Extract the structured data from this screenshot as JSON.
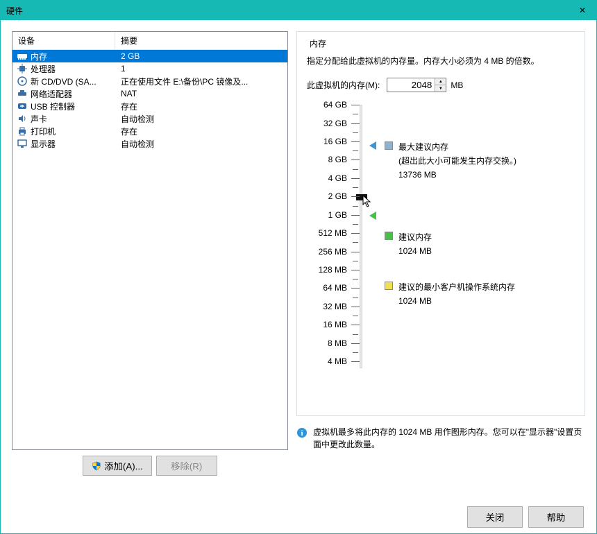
{
  "window": {
    "title": "硬件",
    "close_icon": "✕"
  },
  "device_list": {
    "header_device": "设备",
    "header_summary": "摘要",
    "rows": [
      {
        "icon": "memory",
        "name": "内存",
        "summary": "2 GB",
        "selected": true
      },
      {
        "icon": "cpu",
        "name": "处理器",
        "summary": "1",
        "selected": false
      },
      {
        "icon": "cd",
        "name": "新 CD/DVD (SA...",
        "summary": "正在使用文件 E:\\备份\\PC 镜像及...",
        "selected": false
      },
      {
        "icon": "net",
        "name": "网络适配器",
        "summary": "NAT",
        "selected": false
      },
      {
        "icon": "usb",
        "name": "USB 控制器",
        "summary": "存在",
        "selected": false
      },
      {
        "icon": "sound",
        "name": "声卡",
        "summary": "自动检测",
        "selected": false
      },
      {
        "icon": "printer",
        "name": "打印机",
        "summary": "存在",
        "selected": false
      },
      {
        "icon": "display",
        "name": "显示器",
        "summary": "自动检测",
        "selected": false
      }
    ]
  },
  "buttons": {
    "add": "添加(A)...",
    "remove": "移除(R)"
  },
  "memory_panel": {
    "title": "内存",
    "desc": "指定分配给此虚拟机的内存量。内存大小必须为 4 MB 的倍数。",
    "input_label": "此虚拟机的内存(M):",
    "input_value": "2048",
    "unit": "MB",
    "slider_labels": [
      "64 GB",
      "32 GB",
      "16 GB",
      "8 GB",
      "4 GB",
      "2 GB",
      "1 GB",
      "512 MB",
      "256 MB",
      "128 MB",
      "64 MB",
      "32 MB",
      "16 MB",
      "8 MB",
      "4 MB"
    ],
    "legend_max_title": "最大建议内存",
    "legend_max_note": "(超出此大小可能发生内存交换。)",
    "legend_max_value": "13736 MB",
    "legend_rec_title": "建议内存",
    "legend_rec_value": "1024 MB",
    "legend_min_title": "建议的最小客户机操作系统内存",
    "legend_min_value": "1024 MB",
    "info_text": "虚拟机最多将此内存的 1024 MB 用作图形内存。您可以在\"显示器\"设置页面中更改此数量。"
  },
  "footer": {
    "close": "关闭",
    "help": "帮助"
  }
}
